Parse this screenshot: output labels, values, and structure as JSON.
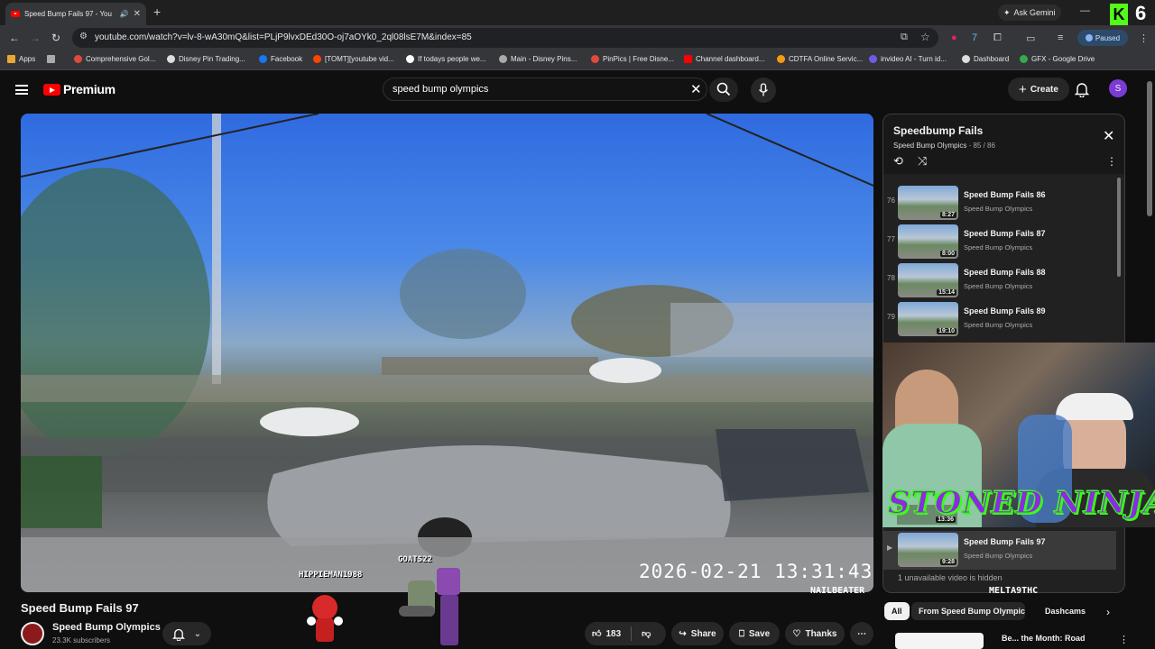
{
  "browser": {
    "tab_title": "Speed Bump Fails 97 - You",
    "new_tab": "+",
    "ask_gemini": "Ask Gemini",
    "kick_count": "6",
    "kick_letter": "K",
    "url": "youtube.com/watch?v=lv-8-wA30mQ&list=PLjP9lvxDEd30O-oj7aOYk0_2ql08lsE7M&index=85",
    "profile_status": "Paused",
    "bookmarks": [
      {
        "label": "Apps",
        "color": "#888"
      },
      {
        "label": "Comprehensive Gol...",
        "color": "#e04a3b"
      },
      {
        "label": "Disney Pin Trading...",
        "color": "#ddd"
      },
      {
        "label": "Facebook",
        "color": "#1877f2"
      },
      {
        "label": "[TOMT][youtube vid...",
        "color": "#ff4500"
      },
      {
        "label": "If todays people we...",
        "color": "#fff"
      },
      {
        "label": "Main - Disney Pins...",
        "color": "#aaa"
      },
      {
        "label": "PinPics | Free Disne...",
        "color": "#e04a3b"
      },
      {
        "label": "Channel dashboard...",
        "color": "#ff0000"
      },
      {
        "label": "CDTFA Online Servic...",
        "color": "#f39c12"
      },
      {
        "label": "invideo AI - Turn id...",
        "color": "#6c5ce7"
      },
      {
        "label": "Dashboard",
        "color": "#ddd"
      },
      {
        "label": "GFX - Google Drive",
        "color": "#34a853"
      }
    ]
  },
  "youtube": {
    "brand": "Premium",
    "search_value": "speed bump olympics",
    "create_label": "Create",
    "avatar_letter": "S"
  },
  "video": {
    "timestamp": "2026-02-21  13:31:43",
    "overlay_names": [
      "HIPPIEMAN1988",
      "GOATS22",
      "NAILBEATER",
      "MELTA9THC"
    ],
    "title": "Speed Bump Fails 97",
    "channel": "Speed Bump Olympics",
    "subscribers": "23.3K subscribers",
    "likes": "183",
    "share": "Share",
    "save": "Save",
    "thanks": "Thanks"
  },
  "playlist": {
    "title": "Speedbump Fails",
    "channel": "Speed Bump Olympics",
    "position": "85 / 86",
    "items": [
      {
        "index": "76",
        "title": "Speed Bump Fails 86",
        "channel": "Speed Bump Olympics",
        "duration": "8:27"
      },
      {
        "index": "77",
        "title": "Speed Bump Fails 87",
        "channel": "Speed Bump Olympics",
        "duration": "8:00"
      },
      {
        "index": "78",
        "title": "Speed Bump Fails 88",
        "channel": "Speed Bump Olympics",
        "duration": "15:14"
      },
      {
        "index": "79",
        "title": "Speed Bump Fails 89",
        "channel": "Speed Bump Olympics",
        "duration": "19:10"
      }
    ],
    "current": {
      "index": "▶",
      "title": "Speed Bump Fails 97",
      "channel": "Speed Bump Olympics",
      "duration": "9:28"
    },
    "partial_duration": "13:36",
    "hidden_note": "1 unavailable video is hidden"
  },
  "overlay": {
    "banner": "STONED NINJA"
  },
  "chips": {
    "all": "All",
    "from_channel": "From Speed Bump Olympics",
    "dashcams": "Dashcams",
    "rec_partial": "Be... the Month: Road"
  }
}
